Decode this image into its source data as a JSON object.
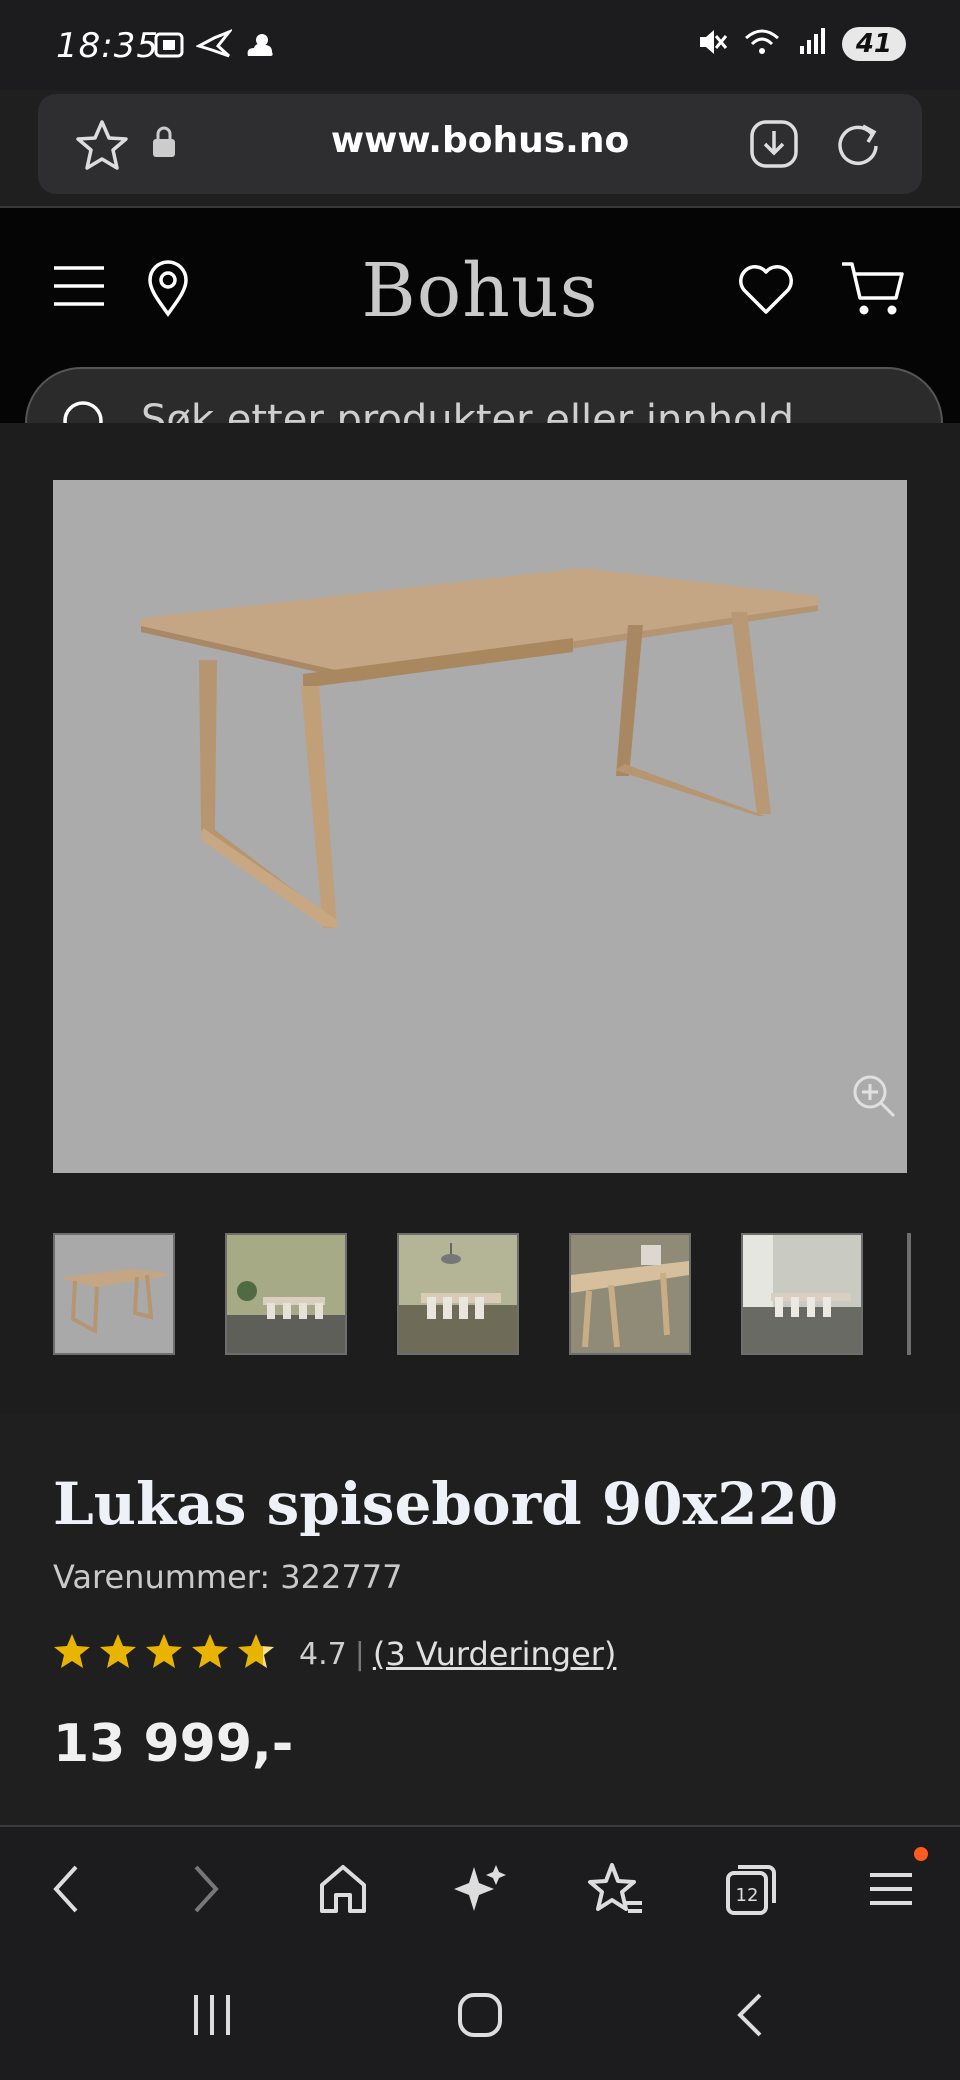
{
  "status_bar": {
    "time": "18:35",
    "battery": "41",
    "left_icons": [
      "screenshot-icon",
      "bird-icon",
      "weather-icon"
    ],
    "right_icons": [
      "mute-icon",
      "wifi-icon",
      "signal-icon"
    ]
  },
  "browser": {
    "url": "www.bohus.no",
    "icons": [
      "star-icon",
      "lock-icon",
      "download-icon",
      "reload-icon"
    ]
  },
  "site_header": {
    "brand": "Bohus",
    "icons": [
      "menu-icon",
      "location-icon",
      "heart-icon",
      "cart-icon"
    ]
  },
  "search": {
    "placeholder": "Søk etter produkter eller innhold .."
  },
  "product": {
    "title": "Lukas spisebord 90x220",
    "sku": "Varenummer: 322777",
    "rating_value": "4.7",
    "rating_stars": 4.7,
    "rating_link": "(3 Vurderinger)",
    "price": "13 999,-",
    "thumbnails": [
      "table-only",
      "dining-room-1",
      "dining-room-2",
      "table-closeup",
      "dining-room-3"
    ]
  },
  "browser_toolbar": {
    "items": [
      "back",
      "forward",
      "home",
      "ai",
      "bookmarks",
      "tabs",
      "menu"
    ],
    "tabs_count": "12",
    "colors": {
      "notification_dot": "#ff5a1f"
    }
  },
  "system_nav": [
    "recents",
    "home",
    "back"
  ],
  "colors": {
    "page_bg": "#1f1f1f",
    "header_bg": "#050505",
    "star": "#e8b400"
  }
}
